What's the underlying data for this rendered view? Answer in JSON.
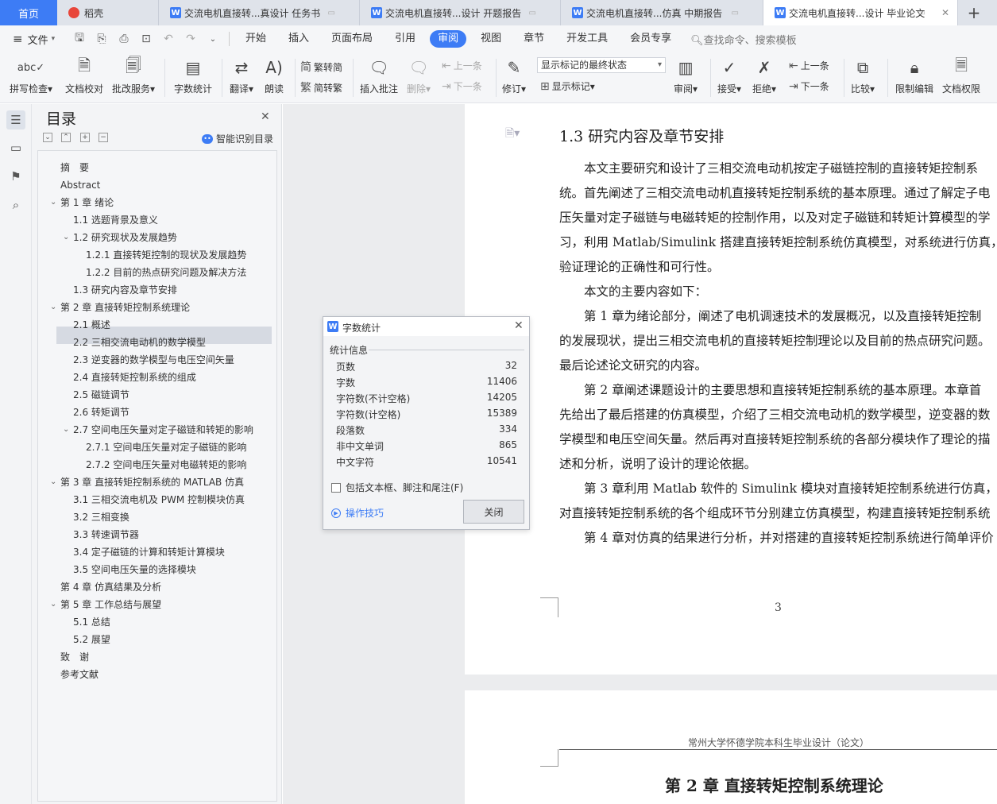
{
  "tabs": [
    {
      "label": "首页",
      "type": "home"
    },
    {
      "label": "稻壳",
      "type": "daoke"
    },
    {
      "label": "交流电机直接转...真设计 任务书",
      "type": "doc"
    },
    {
      "label": "交流电机直接转...设计 开题报告",
      "type": "doc"
    },
    {
      "label": "交流电机直接转...仿真 中期报告",
      "type": "doc"
    },
    {
      "label": "交流电机直接转...设计 毕业论文",
      "type": "doc",
      "active": true
    }
  ],
  "menu": {
    "file": "文件",
    "items": [
      "开始",
      "插入",
      "页面布局",
      "引用",
      "审阅",
      "视图",
      "章节",
      "开发工具",
      "会员专享"
    ],
    "active": "审阅",
    "search": "查找命令、搜索模板"
  },
  "ribbon": {
    "spellcheck": "拼写检查",
    "doccheck": "文档校对",
    "annotate_service": "批改服务",
    "wordcount": "字数统计",
    "translate": "翻译",
    "read": "朗读",
    "trad": "繁转简",
    "simp": "简转繁",
    "insert_comment": "插入批注",
    "delete": "删除",
    "prev_comment": "上一条",
    "next_comment": "下一条",
    "revise": "修订",
    "markup_state": "显示标记的最终状态",
    "show_markup": "显示标记",
    "review": "审阅",
    "accept": "接受",
    "reject": "拒绝",
    "prev_change": "上一条",
    "next_change": "下一条",
    "compare": "比较",
    "restrict": "限制编辑",
    "doc_permission": "文档权限"
  },
  "toc": {
    "title": "目录",
    "smart": "智能识别目录",
    "items": [
      {
        "text": "摘　要",
        "level": 1
      },
      {
        "text": "Abstract",
        "level": 1
      },
      {
        "text": "第 1 章 绪论",
        "level": 1,
        "expand": true
      },
      {
        "text": "1.1 选题背景及意义",
        "level": 2
      },
      {
        "text": "1.2 研究现状及发展趋势",
        "level": 2,
        "expand": true
      },
      {
        "text": "1.2.1 直接转矩控制的现状及发展趋势",
        "level": 3
      },
      {
        "text": "1.2.2 目前的热点研究问题及解决方法",
        "level": 3
      },
      {
        "text": "1.3 研究内容及章节安排",
        "level": 2,
        "selected": true
      },
      {
        "text": "第 2 章 直接转矩控制系统理论",
        "level": 1,
        "expand": true
      },
      {
        "text": "2.1 概述",
        "level": 2
      },
      {
        "text": "2.2 三相交流电动机的数学模型",
        "level": 2
      },
      {
        "text": "2.3 逆变器的数学模型与电压空间矢量",
        "level": 2
      },
      {
        "text": "2.4 直接转矩控制系统的组成",
        "level": 2
      },
      {
        "text": "2.5 磁链调节",
        "level": 2
      },
      {
        "text": "2.6 转矩调节",
        "level": 2
      },
      {
        "text": "2.7 空间电压矢量对定子磁链和转矩的影响",
        "level": 2,
        "expand": true
      },
      {
        "text": "2.7.1 空间电压矢量对定子磁链的影响",
        "level": 3
      },
      {
        "text": "2.7.2 空间电压矢量对电磁转矩的影响",
        "level": 3
      },
      {
        "text": "第 3 章 直接转矩控制系统的 MATLAB 仿真",
        "level": 1,
        "expand": true
      },
      {
        "text": "3.1 三相交流电机及 PWM 控制模块仿真",
        "level": 2
      },
      {
        "text": "3.2 三相变换",
        "level": 2
      },
      {
        "text": "3.3 转速调节器",
        "level": 2
      },
      {
        "text": "3.4 定子磁链的计算和转矩计算模块",
        "level": 2
      },
      {
        "text": "3.5 空间电压矢量的选择模块",
        "level": 2
      },
      {
        "text": "第 4 章 仿真结果及分析",
        "level": 1
      },
      {
        "text": "第 5 章 工作总结与展望",
        "level": 1,
        "expand": true
      },
      {
        "text": "5.1 总结",
        "level": 2
      },
      {
        "text": "5.2 展望",
        "level": 2
      },
      {
        "text": "致　谢",
        "level": 1
      },
      {
        "text": "参考文献",
        "level": 1
      }
    ]
  },
  "document": {
    "heading": "1.3  研究内容及章节安排",
    "lines": [
      "　　本文主要研究和设计了三相交流电动机按定子磁链控制的直接转矩控制系",
      "统。首先阐述了三相交流电动机直接转矩控制系统的基本原理。通过了解定子电",
      "压矢量对定子磁链与电磁转矩的控制作用，以及对定子磁链和转矩计算模型的学",
      "习，利用 Matlab/Simulink 搭建直接转矩控制系统仿真模型，对系统进行仿真，",
      "验证理论的正确性和可行性。",
      "　　本文的主要内容如下：",
      "　　第 1 章为绪论部分，阐述了电机调速技术的发展概况，以及直接转矩控制",
      "的发展现状，提出三相交流电机的直接转矩控制理论以及目前的热点研究问题。",
      "最后论述论文研究的内容。",
      "　　第 2 章阐述课题设计的主要思想和直接转矩控制系统的基本原理。本章首",
      "先给出了最后搭建的仿真模型，介绍了三相交流电动机的数学模型，逆变器的数",
      "学模型和电压空间矢量。然后再对直接转矩控制系统的各部分模块作了理论的描",
      "述和分析，说明了设计的理论依据。",
      "　　第 3 章利用  Matlab 软件的 Simulink 模块对直接转矩控制系统进行仿真，针",
      "对直接转矩控制系统的各个组成环节分别建立仿真模型，构建直接转矩控制系统",
      "　　第 4 章对仿真的结果进行分析，并对搭建的直接转矩控制系统进行简单评价"
    ],
    "page_number": "3",
    "page2_header": "常州大学怀德学院本科生毕业设计（论文）",
    "chapter_title": "第 2 章  直接转矩控制系统理论"
  },
  "dialog": {
    "title": "字数统计",
    "section": "统计信息",
    "stats": [
      {
        "label": "页数",
        "value": "32"
      },
      {
        "label": "字数",
        "value": "11406"
      },
      {
        "label": "字符数(不计空格)",
        "value": "14205"
      },
      {
        "label": "字符数(计空格)",
        "value": "15389"
      },
      {
        "label": "段落数",
        "value": "334"
      },
      {
        "label": "非中文单词",
        "value": "865"
      },
      {
        "label": "中文字符",
        "value": "10541"
      }
    ],
    "include_label": "包括文本框、脚注和尾注(F)",
    "tips": "操作技巧",
    "close": "关闭"
  },
  "icons": {
    "accent": "#3d7cf5"
  }
}
